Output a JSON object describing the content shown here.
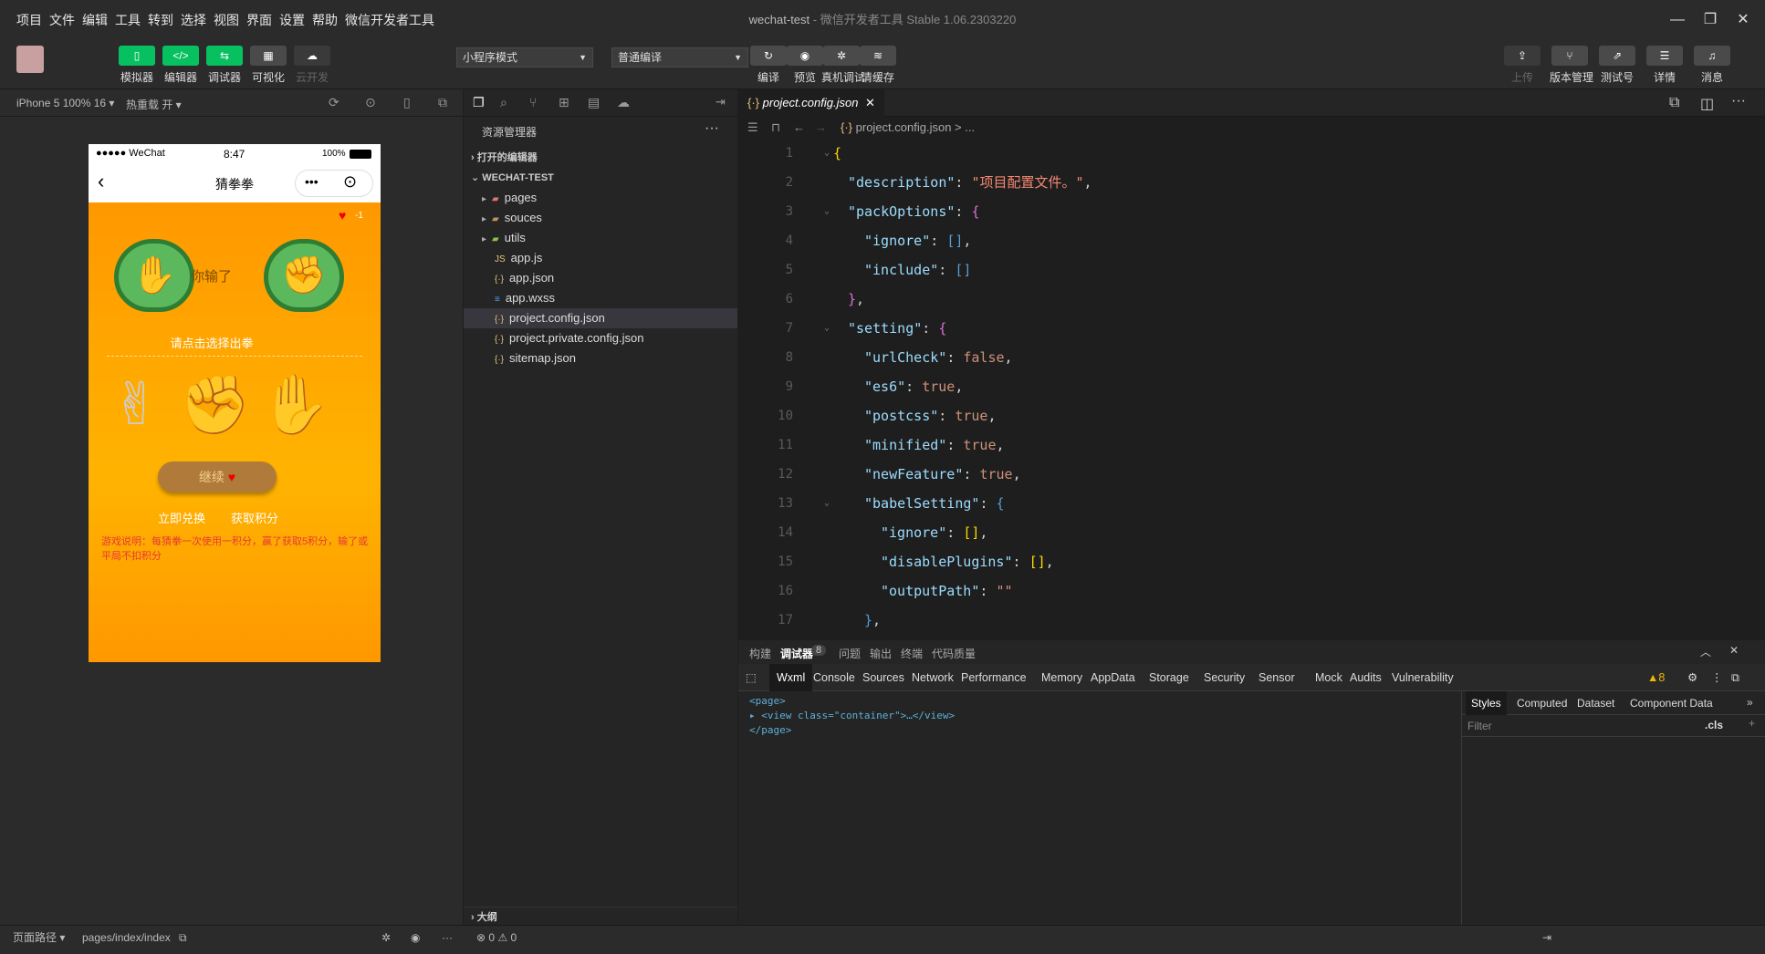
{
  "menu": [
    "项目",
    "文件",
    "编辑",
    "工具",
    "转到",
    "选择",
    "视图",
    "界面",
    "设置",
    "帮助",
    "微信开发者工具"
  ],
  "window": {
    "title": "wechat-test",
    "subtitle": " - 微信开发者工具 Stable 1.06.2303220"
  },
  "toolbar": {
    "left": [
      {
        "label": "模拟器",
        "icon": "phone-icon",
        "glyph": "▯"
      },
      {
        "label": "编辑器",
        "icon": "code-icon",
        "glyph": "</>"
      },
      {
        "label": "调试器",
        "icon": "debug-icon",
        "glyph": "⇆"
      },
      {
        "label": "可视化",
        "icon": "layout-icon",
        "glyph": "▦"
      },
      {
        "label": "云开发",
        "icon": "cloud-icon",
        "glyph": "☁"
      }
    ],
    "mode": "小程序模式",
    "compile": "普通编译",
    "mid": [
      {
        "label": "编译",
        "icon": "refresh-icon",
        "glyph": "↻"
      },
      {
        "label": "预览",
        "icon": "eye-icon",
        "glyph": "◉"
      },
      {
        "label": "真机调试",
        "icon": "bug-icon",
        "glyph": "✲"
      },
      {
        "label": "清缓存",
        "icon": "layers-icon",
        "glyph": "≋"
      }
    ],
    "right": [
      {
        "label": "上传",
        "icon": "upload-icon",
        "glyph": "⇪"
      },
      {
        "label": "版本管理",
        "icon": "branch-icon",
        "glyph": "⑂"
      },
      {
        "label": "测试号",
        "icon": "external-icon",
        "glyph": "⇗"
      },
      {
        "label": "详情",
        "icon": "menu-icon",
        "glyph": "☰"
      },
      {
        "label": "消息",
        "icon": "bell-icon",
        "glyph": "♫"
      }
    ]
  },
  "sim": {
    "device": "iPhone 5 100% 16",
    "hotreload": "热重载 开",
    "status": {
      "carrier": "●●●●● WeChat",
      "time": "8:47",
      "battery": "100%"
    },
    "nav_title": "猜拳拳",
    "lives": "-1",
    "result": "你输了",
    "hint": "请点击选择出拳",
    "continue": "继续",
    "link1": "立即兑换",
    "link2": "获取积分",
    "rules": "游戏说明：每猜拳一次使用一积分，赢了获取5积分，输了或平局不扣积分"
  },
  "explorer": {
    "title": "资源管理器",
    "open_editors": "打开的编辑器",
    "project": "WECHAT-TEST",
    "outline": "大纲",
    "items": [
      {
        "name": "pages",
        "type": "folder"
      },
      {
        "name": "souces",
        "type": "folder"
      },
      {
        "name": "utils",
        "type": "folder"
      },
      {
        "name": "app.js",
        "type": "js"
      },
      {
        "name": "app.json",
        "type": "json"
      },
      {
        "name": "app.wxss",
        "type": "css"
      },
      {
        "name": "project.config.json",
        "type": "json"
      },
      {
        "name": "project.private.config.json",
        "type": "json"
      },
      {
        "name": "sitemap.json",
        "type": "json"
      }
    ]
  },
  "editor": {
    "tab": "project.config.json",
    "breadcrumb": "project.config.json > ..."
  },
  "devtools": {
    "top_tabs": [
      "构建",
      "调试器",
      "问题",
      "输出",
      "终端",
      "代码质量"
    ],
    "badge": "8",
    "tabs": [
      "Wxml",
      "Console",
      "Sources",
      "Network",
      "Performance",
      "Memory",
      "AppData",
      "Storage",
      "Security",
      "Sensor",
      "Mock",
      "Audits",
      "Vulnerability"
    ],
    "warn": "▲8",
    "wxml": [
      "<page>",
      "<view class=\"container\">…</view>",
      "</page>"
    ],
    "style_tabs": [
      "Styles",
      "Computed",
      "Dataset",
      "Component Data"
    ],
    "filter": "Filter",
    "cls": ".cls"
  },
  "bottom": {
    "path_label": "页面路径",
    "path": "pages/index/index",
    "errors": "0",
    "warnings": "0"
  }
}
